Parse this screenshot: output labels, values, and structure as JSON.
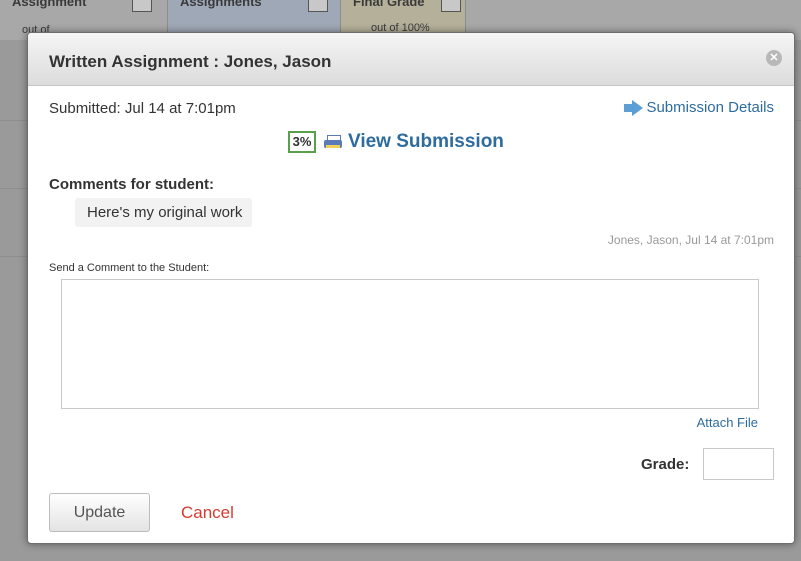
{
  "background": {
    "columns": [
      {
        "title": "Assignment",
        "sub": "out of"
      },
      {
        "title": "Assignments",
        "sub": ""
      },
      {
        "title": "Final Grade",
        "sub": "out of 100%"
      }
    ]
  },
  "modal": {
    "title": "Written Assignment : Jones, Jason",
    "submitted": "Submitted: Jul 14 at 7:01pm",
    "submission_details": "Submission Details",
    "score_badge": "3%",
    "view_submission": "View Submission",
    "comments_label": "Comments for student:",
    "comment_text": "Here's my original work",
    "comment_meta": "Jones, Jason, Jul 14 at 7:01pm",
    "send_comment_label": "Send a Comment to the Student:",
    "comment_input_value": "",
    "attach_file": "Attach File",
    "grade_label": "Grade:",
    "grade_value": "",
    "update_button": "Update",
    "cancel_link": "Cancel"
  }
}
